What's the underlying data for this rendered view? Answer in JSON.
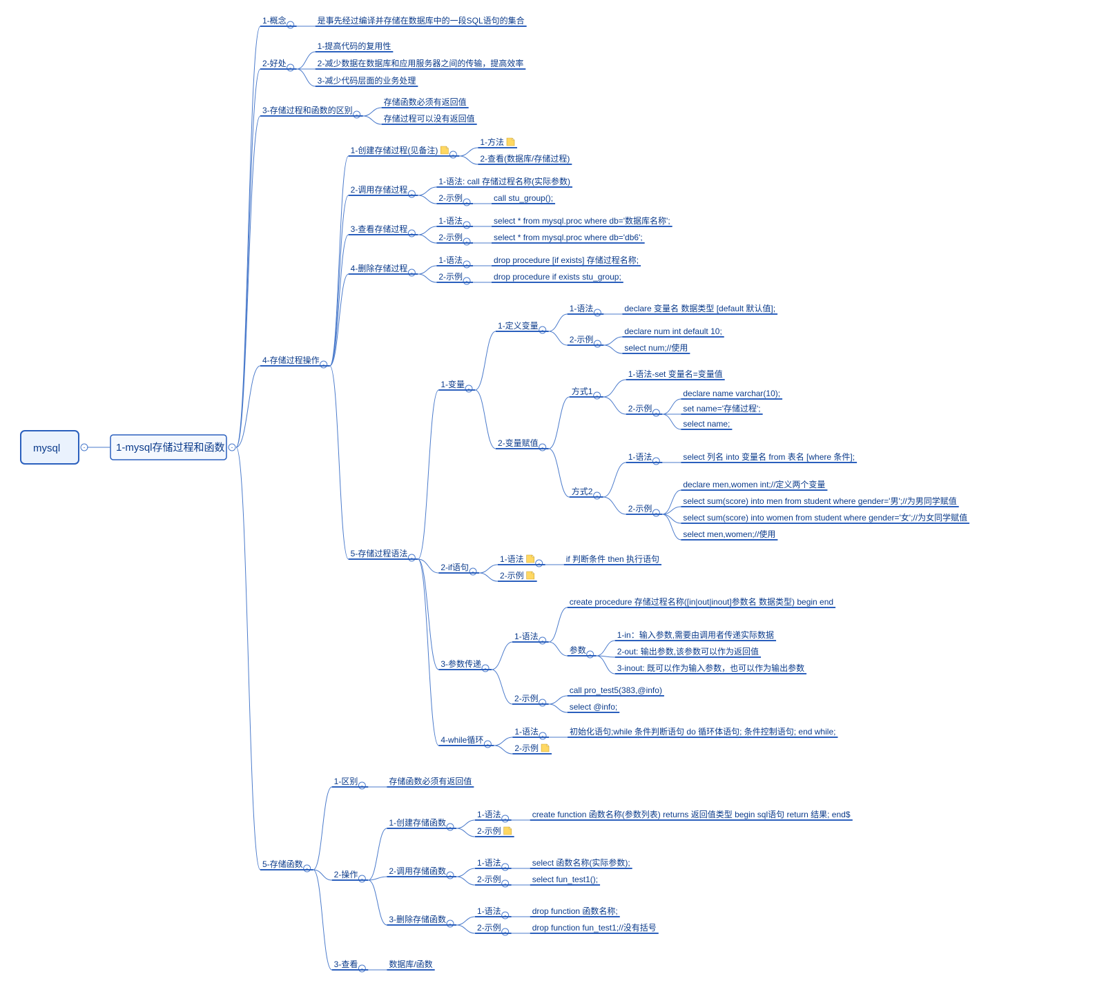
{
  "root": {
    "label": "mysql"
  },
  "sub": {
    "label": "1-mysql存储过程和函数"
  },
  "n": {
    "n1": "1-概念",
    "n1_1": "是事先经过编译并存储在数据库中的一段SQL语句的集合",
    "n2": "2-好处",
    "n2_1": "1-提高代码的复用性",
    "n2_2": "2-减少数据在数据库和应用服务器之间的传输，提高效率",
    "n2_3": "3-减少代码层面的业务处理",
    "n3": "3-存储过程和函数的区别",
    "n3_1": "存储函数必须有返回值",
    "n3_2": "存储过程可以没有返回值",
    "n4": "4-存储过程操作",
    "n41": "1-创建存储过程(见备注)",
    "n41_1": "1-方法",
    "n41_2": "2-查看(数据库/存储过程)",
    "n42": "2-调用存储过程",
    "n42_1": "1-语法: call 存储过程名称(实际参数)",
    "n42_2": "2-示例",
    "n42_2v": "call stu_group();",
    "n43": "3-查看存储过程",
    "n43_1": "1-语法",
    "n43_1v": "select * from mysql.proc where db='数据库名称';",
    "n43_2": "2-示例",
    "n43_2v": "select * from mysql.proc where db='db6';",
    "n44": "4-删除存储过程",
    "n44_1": "1-语法",
    "n44_1v": "drop procedure [if exists] 存储过程名称;",
    "n44_2": "2-示例",
    "n44_2v": "drop procedure if exists stu_group;",
    "n45": "5-存储过程语法",
    "n451": "1-变量",
    "n4511": "1-定义变量",
    "n4511_1": "1-语法",
    "n4511_1v": "declare 变量名 数据类型 [default 默认值];",
    "n4511_2": "2-示例",
    "n4511_2a": "declare num int default 10;",
    "n4511_2b": "select num;//使用",
    "n4512": "2-变量赋值",
    "m1": "方式1",
    "m1_1": "1-语法-set 变量名=变量值",
    "m1_2": "2-示例",
    "m1_2a": "declare name varchar(10);",
    "m1_2b": "set name='存储过程';",
    "m1_2c": "select name;",
    "m2": "方式2",
    "m2_1": "1-语法",
    "m2_1v": "select 列名 into 变量名 from 表名 [where 条件];",
    "m2_2": "2-示例",
    "m2_2a": "declare men,women int;//定义两个变量",
    "m2_2b": "select sum(score) into men from student where gender='男';//为男同学赋值",
    "m2_2c": "select sum(score) into women from student where gender='女';//为女同学赋值",
    "m2_2d": "select men,women;//使用",
    "n452": "2-if语句",
    "n452_1": "1-语法",
    "n452_1v": "if 判断条件 then 执行语句",
    "n452_2": "2-示例",
    "n453": "3-参数传递",
    "n4531": "1-语法",
    "n4531v": "create procedure 存储过程名称([in|out|inout]参数名 数据类型) begin end",
    "p": "参数",
    "p1": "1-in：输入参数,需要由调用者传递实际数据",
    "p2": "2-out: 输出参数,该参数可以作为返回值",
    "p3": "3-inout: 既可以作为输入参数，也可以作为输出参数",
    "n4532": "2-示例",
    "n4532a": "call pro_test5(383,@info)",
    "n4532b": "select @info;",
    "n454": "4-while循环",
    "n454_1": "1-语法",
    "n454_1v": "初始化语句;while 条件判断语句 do 循环体语句; 条件控制语句; end while;",
    "n454_2": "2-示例",
    "n5": "5-存储函数",
    "n51": "1-区别",
    "n51v": "存储函数必须有返回值",
    "n52": "2-操作",
    "n521": "1-创建存储函数",
    "n521_1": "1-语法",
    "n521_1v": "create function 函数名称(参数列表) returns 返回值类型 begin sql语句 return 结果; end$",
    "n521_2": "2-示例",
    "n522": "2-调用存储函数",
    "n522_1": "1-语法",
    "n522_1v": "select 函数名称(实际参数);",
    "n522_2": "2-示例",
    "n522_2v": "select fun_test1();",
    "n523": "3-删除存储函数",
    "n523_1": "1-语法",
    "n523_1v": "drop function 函数名称;",
    "n523_2": "2-示例",
    "n523_2v": "drop function fun_test1;//没有括号",
    "n53": "3-查看",
    "n53v": "数据库/函数"
  }
}
